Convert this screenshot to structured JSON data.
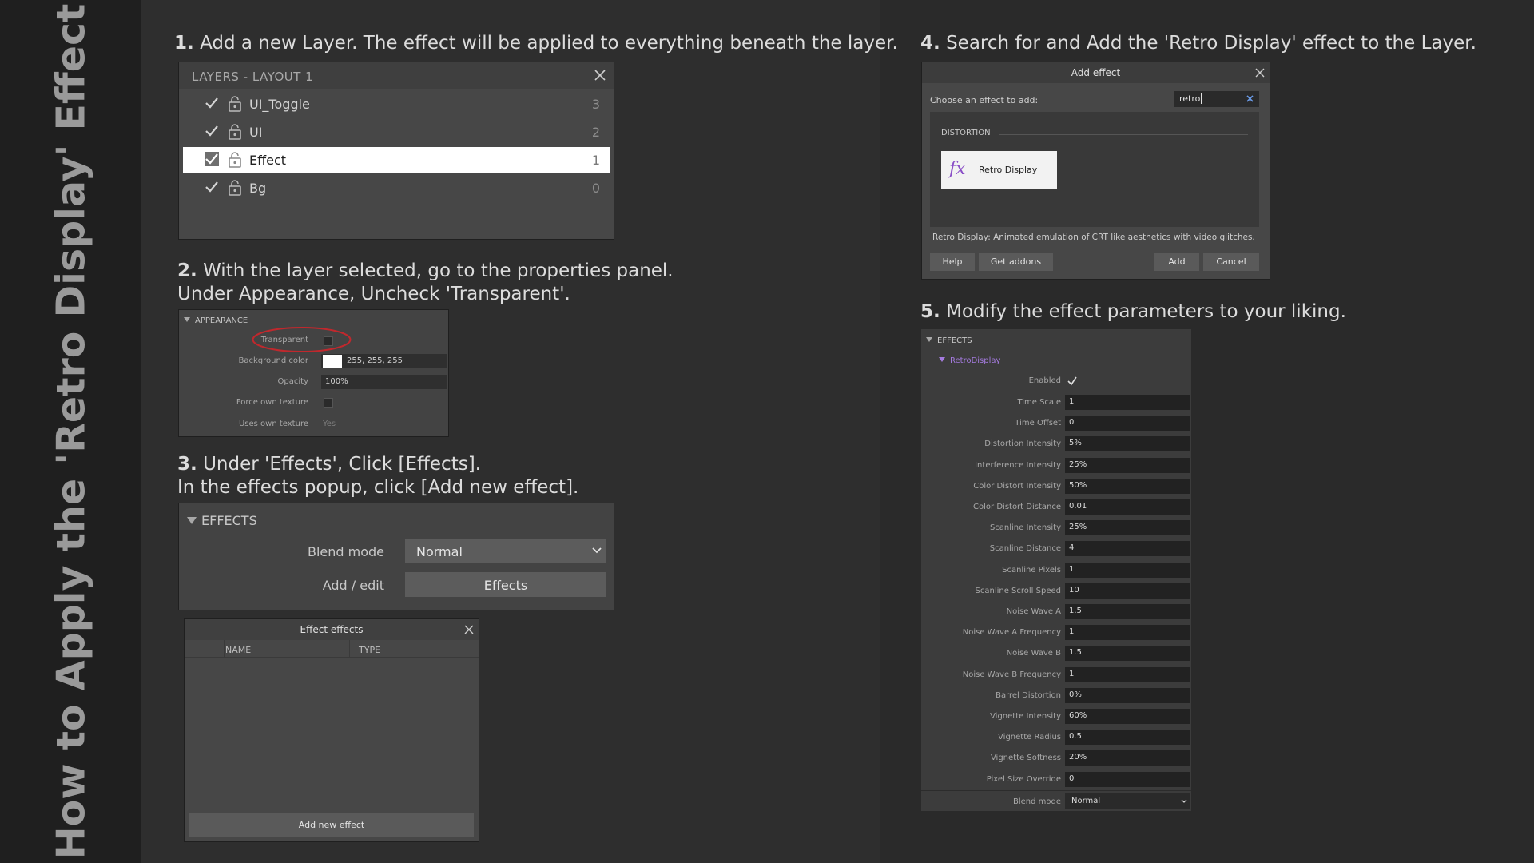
{
  "sidebar": {
    "title": "How to Apply the 'Retro Display' Effect"
  },
  "steps": {
    "s1": {
      "num": "1.",
      "text": "Add a new Layer. The effect will be applied to everything beneath the layer."
    },
    "s2": {
      "num": "2.",
      "text": "With the layer selected, go to the properties panel.",
      "text2": "Under Appearance, Uncheck 'Transparent'."
    },
    "s3": {
      "num": "3.",
      "text": "Under 'Effects', Click [Effects].",
      "text2": "In the effects popup, click [Add new effect]."
    },
    "s4": {
      "num": "4.",
      "text": "Search for and Add the 'Retro Display' effect to the Layer."
    },
    "s5": {
      "num": "5.",
      "text": "Modify the effect parameters to your liking."
    }
  },
  "layers_panel": {
    "title": "LAYERS - LAYOUT 1",
    "layers": [
      {
        "name": "UI_Toggle",
        "index": "3"
      },
      {
        "name": "UI",
        "index": "2"
      },
      {
        "name": "Effect",
        "index": "1"
      },
      {
        "name": "Bg",
        "index": "0"
      }
    ]
  },
  "appearance_panel": {
    "header": "APPEARANCE",
    "transparent_label": "Transparent",
    "bg_color_label": "Background color",
    "bg_color_value": "255, 255, 255",
    "opacity_label": "Opacity",
    "opacity_value": "100%",
    "force_texture_label": "Force own texture",
    "uses_texture_label": "Uses own texture",
    "uses_texture_value": "Yes",
    "highlight_color": "#c0282d"
  },
  "effects_panel": {
    "header": "EFFECTS",
    "blend_label": "Blend mode",
    "blend_value": "Normal",
    "addedit_label": "Add / edit",
    "effects_button": "Effects"
  },
  "effect_effects_dialog": {
    "title": "Effect effects",
    "col_name": "NAME",
    "col_type": "TYPE",
    "add_button": "Add new effect"
  },
  "add_effect_dialog": {
    "title": "Add effect",
    "choose_label": "Choose an effect to add:",
    "search_value": "retro",
    "category": "DISTORTION",
    "effect_name": "Retro Display",
    "fx_symbol": "fx",
    "fx_color": "#8a4fc7",
    "description": "Retro Display: Animated emulation of CRT like aesthetics with video glitches.",
    "help_button": "Help",
    "addons_button": "Get addons",
    "add_button": "Add",
    "cancel_button": "Cancel"
  },
  "effect_params": {
    "header": "EFFECTS",
    "effect_name": "RetroDisplay",
    "effect_name_color": "#a57be0",
    "enabled_label": "Enabled",
    "params": [
      {
        "label": "Time Scale",
        "value": "1"
      },
      {
        "label": "Time Offset",
        "value": "0"
      },
      {
        "label": "Distortion Intensity",
        "value": "5%"
      },
      {
        "label": "Interference Intensity",
        "value": "25%"
      },
      {
        "label": "Color Distort Intensity",
        "value": "50%"
      },
      {
        "label": "Color Distort Distance",
        "value": "0.01"
      },
      {
        "label": "Scanline Intensity",
        "value": "25%"
      },
      {
        "label": "Scanline Distance",
        "value": "4"
      },
      {
        "label": "Scanline Pixels",
        "value": "1"
      },
      {
        "label": "Scanline Scroll Speed",
        "value": "10"
      },
      {
        "label": "Noise Wave A",
        "value": "1.5"
      },
      {
        "label": "Noise Wave A Frequency",
        "value": "1"
      },
      {
        "label": "Noise Wave B",
        "value": "1.5"
      },
      {
        "label": "Noise Wave B Frequency",
        "value": "1"
      },
      {
        "label": "Barrel Distortion",
        "value": "0%"
      },
      {
        "label": "Vignette Intensity",
        "value": "60%"
      },
      {
        "label": "Vignette Radius",
        "value": "0.5"
      },
      {
        "label": "Vignette Softness",
        "value": "20%"
      },
      {
        "label": "Pixel Size Override",
        "value": "0"
      }
    ],
    "blend_label": "Blend mode",
    "blend_value": "Normal"
  }
}
